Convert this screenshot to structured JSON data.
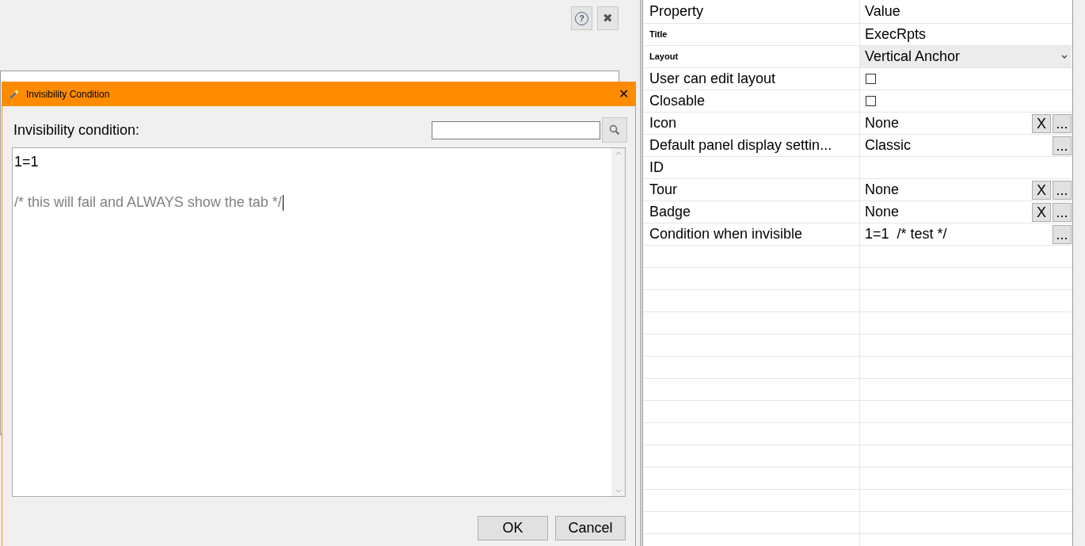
{
  "toolbar": {
    "help_button": "?",
    "close_button": "✖"
  },
  "dialog": {
    "title": "Invisibility Condition",
    "close": "✕",
    "label": "Invisibility condition:",
    "editor": {
      "lines": [
        {
          "kind": "code",
          "text": "1=1"
        },
        {
          "kind": "comment",
          "text": "/* this will fail and ALWAYS show the tab */"
        }
      ],
      "cursor": true
    },
    "buttons": [
      {
        "label": "OK"
      },
      {
        "label": "Cancel"
      }
    ]
  },
  "properties": {
    "columns": [
      "Property",
      "Value"
    ],
    "rows": [
      {
        "property": "Title",
        "emphasized": true,
        "kind": "text",
        "value": "ExecRpts"
      },
      {
        "property": "Layout",
        "emphasized": true,
        "kind": "dropdown",
        "value": "Vertical Anchor"
      },
      {
        "property": "User can edit layout",
        "emphasized": false,
        "kind": "checkbox",
        "checked": false
      },
      {
        "property": "Closable",
        "emphasized": false,
        "kind": "checkbox",
        "checked": false
      },
      {
        "property": "Icon",
        "emphasized": false,
        "kind": "text",
        "value": "None",
        "clear_button": "X",
        "more_button": "..."
      },
      {
        "property": "Default panel display settin...",
        "emphasized": false,
        "kind": "text",
        "value": "Classic",
        "more_button": "..."
      },
      {
        "property": "ID",
        "emphasized": false,
        "kind": "text"
      },
      {
        "property": "Tour",
        "emphasized": false,
        "kind": "text",
        "value": "None",
        "clear_button": "X",
        "more_button": "..."
      },
      {
        "property": "Badge",
        "emphasized": false,
        "kind": "text",
        "value": "None",
        "clear_button": "X",
        "more_button": "..."
      },
      {
        "property": "Condition when invisible",
        "emphasized": false,
        "kind": "text",
        "value": "1=1  /* test */",
        "more_button": "..."
      }
    ]
  }
}
